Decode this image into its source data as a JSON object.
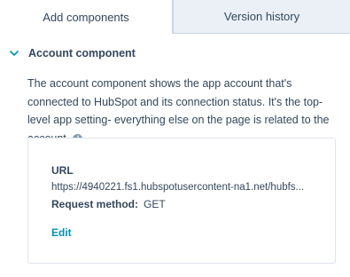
{
  "tabs": [
    {
      "label": "Add components",
      "active": true
    },
    {
      "label": "Version history",
      "active": false
    }
  ],
  "section": {
    "title": "Account component",
    "chevron_icon": "chevron-down-icon",
    "description": "The account component shows the app account that's connected to HubSpot and its connection status. It's the top-level app setting- everything else on the page is related to the account.",
    "info_icon": "info-icon"
  },
  "card": {
    "url_label": "URL",
    "url_value": "https://4940221.fs1.hubspotusercontent-na1.net/hubfs...",
    "method_label": "Request method:",
    "method_value": "GET",
    "edit_label": "Edit"
  },
  "colors": {
    "text": "#33475b",
    "link": "#0091ae",
    "inactive_tab_bg": "#eaf0f6",
    "border": "#cbd6e2"
  }
}
